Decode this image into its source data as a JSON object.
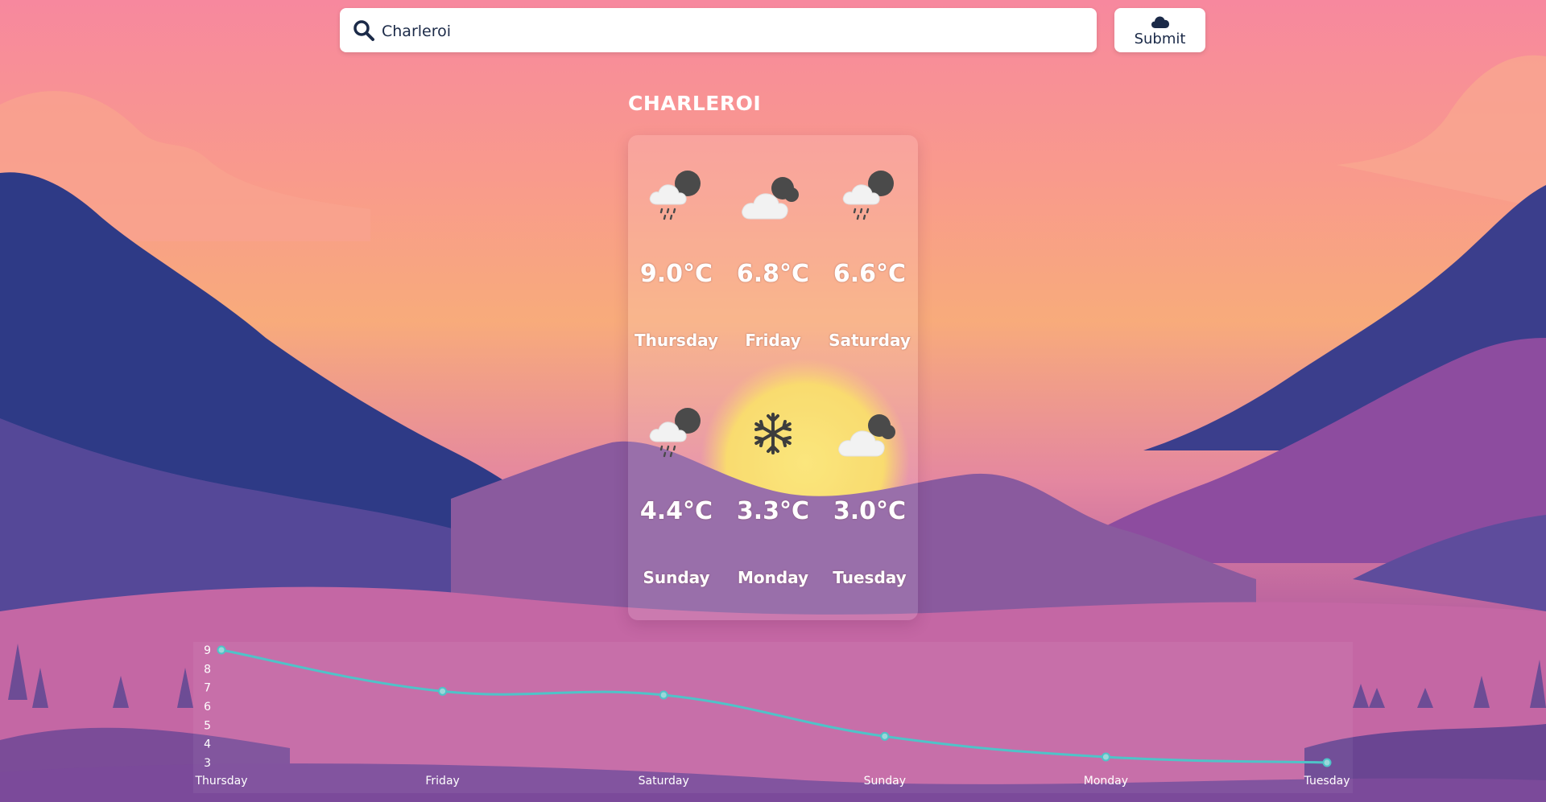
{
  "search": {
    "value": "Charleroi",
    "placeholder": ""
  },
  "submit": {
    "label": "Submit"
  },
  "city": "CHARLEROI",
  "forecast": [
    {
      "icon": "rain-cloud-sun-icon",
      "temp": "9.0°C",
      "day": "Thursday"
    },
    {
      "icon": "cloud-sun-icon",
      "temp": "6.8°C",
      "day": "Friday"
    },
    {
      "icon": "rain-cloud-sun-icon",
      "temp": "6.6°C",
      "day": "Saturday"
    },
    {
      "icon": "rain-cloud-sun-icon",
      "temp": "4.4°C",
      "day": "Sunday"
    },
    {
      "icon": "snowflake-icon",
      "temp": "3.3°C",
      "day": "Monday"
    },
    {
      "icon": "cloud-sun-icon",
      "temp": "3.0°C",
      "day": "Tuesday"
    }
  ],
  "colors": {
    "line": "#4fc3c8",
    "accent": "#1b2a48"
  },
  "chart_data": {
    "type": "line",
    "categories": [
      "Thursday",
      "Friday",
      "Saturday",
      "Sunday",
      "Monday",
      "Tuesday"
    ],
    "series": [
      {
        "values": [
          9.0,
          6.8,
          6.6,
          4.4,
          3.3,
          3.0
        ]
      }
    ],
    "yticks": [
      3,
      4,
      5,
      6,
      7,
      8,
      9
    ],
    "ylim": [
      3,
      9
    ],
    "grid": false,
    "legend": "none"
  }
}
